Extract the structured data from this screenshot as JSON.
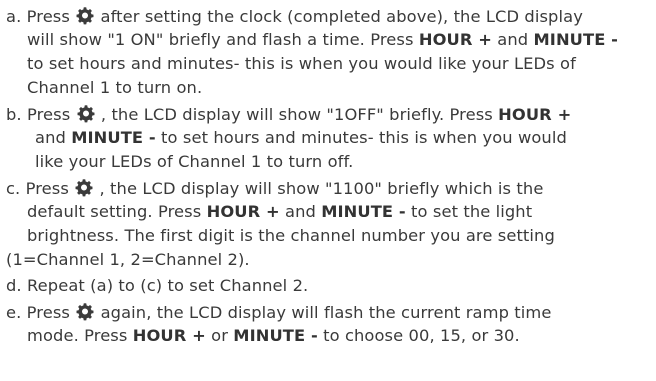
{
  "instructions": {
    "a": {
      "l1_pre": "a. Press ",
      "l1_post": " after setting the clock (completed above), the LCD display",
      "l2_pre": "will show \"1 ON\" briefly and flash a time. Press ",
      "l2_b1": "HOUR +",
      "l2_mid": " and ",
      "l2_b2": "MINUTE -",
      "l3": "to set hours and minutes- this is when you would like your LEDs of",
      "l4": "Channel 1 to turn on."
    },
    "b": {
      "l1_pre": "b. Press ",
      "l1_post": " , the LCD display will show \"1OFF\" briefly. Press ",
      "l1_b1": "HOUR +",
      "l2_pre": "and ",
      "l2_b2": "MINUTE -",
      "l2_post": " to set hours and minutes- this is when you would",
      "l3": "like your LEDs of Channel 1 to turn off."
    },
    "c": {
      "l1_pre": "c. Press ",
      "l1_post": " , the LCD display will show \"1100\" briefly which is the",
      "l2_pre": "default setting. Press ",
      "l2_b1": "HOUR +",
      "l2_mid": " and ",
      "l2_b2": "MINUTE -",
      "l2_post": " to set the light",
      "l3": "brightness. The first digit is the channel number you are setting",
      "l4": "(1=Channel 1, 2=Channel 2)."
    },
    "d": {
      "l1": "d. Repeat (a) to (c) to set Channel 2."
    },
    "e": {
      "l1_pre": "e. Press ",
      "l1_post": " again, the LCD display will flash the current ramp time",
      "l2_pre": "mode. Press ",
      "l2_b1": "HOUR +",
      "l2_mid": " or ",
      "l2_b2": "MINUTE -",
      "l2_post": " to choose 00, 15, or 30."
    }
  },
  "icons": {
    "gear_color": "#3b3b3b",
    "gear_name": "gear-icon"
  }
}
